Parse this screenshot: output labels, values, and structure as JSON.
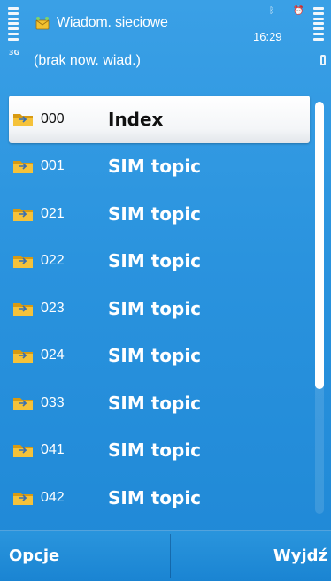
{
  "header": {
    "title": "Wiadom. sieciowe",
    "subtitle": "(brak now. wiad.)",
    "clock": "16:29",
    "network_label": "3G",
    "icons": [
      "signal-strength-icon",
      "network-3g-icon",
      "messages-icon",
      "bluetooth-icon",
      "alarm-icon",
      "battery-icon"
    ]
  },
  "list": {
    "items": [
      {
        "number": "000",
        "label": "Index",
        "selected": true
      },
      {
        "number": "001",
        "label": "SIM topic",
        "selected": false
      },
      {
        "number": "021",
        "label": "SIM topic",
        "selected": false
      },
      {
        "number": "022",
        "label": "SIM topic",
        "selected": false
      },
      {
        "number": "023",
        "label": "SIM topic",
        "selected": false
      },
      {
        "number": "024",
        "label": "SIM topic",
        "selected": false
      },
      {
        "number": "033",
        "label": "SIM topic",
        "selected": false
      },
      {
        "number": "041",
        "label": "SIM topic",
        "selected": false
      },
      {
        "number": "042",
        "label": "SIM topic",
        "selected": false
      }
    ]
  },
  "softkeys": {
    "left": "Opcje",
    "right": "Wyjdź"
  },
  "colors": {
    "background": "#2a93de",
    "selection": "#ffffff",
    "folder": "#f0b21f",
    "text": "#ffffff"
  }
}
